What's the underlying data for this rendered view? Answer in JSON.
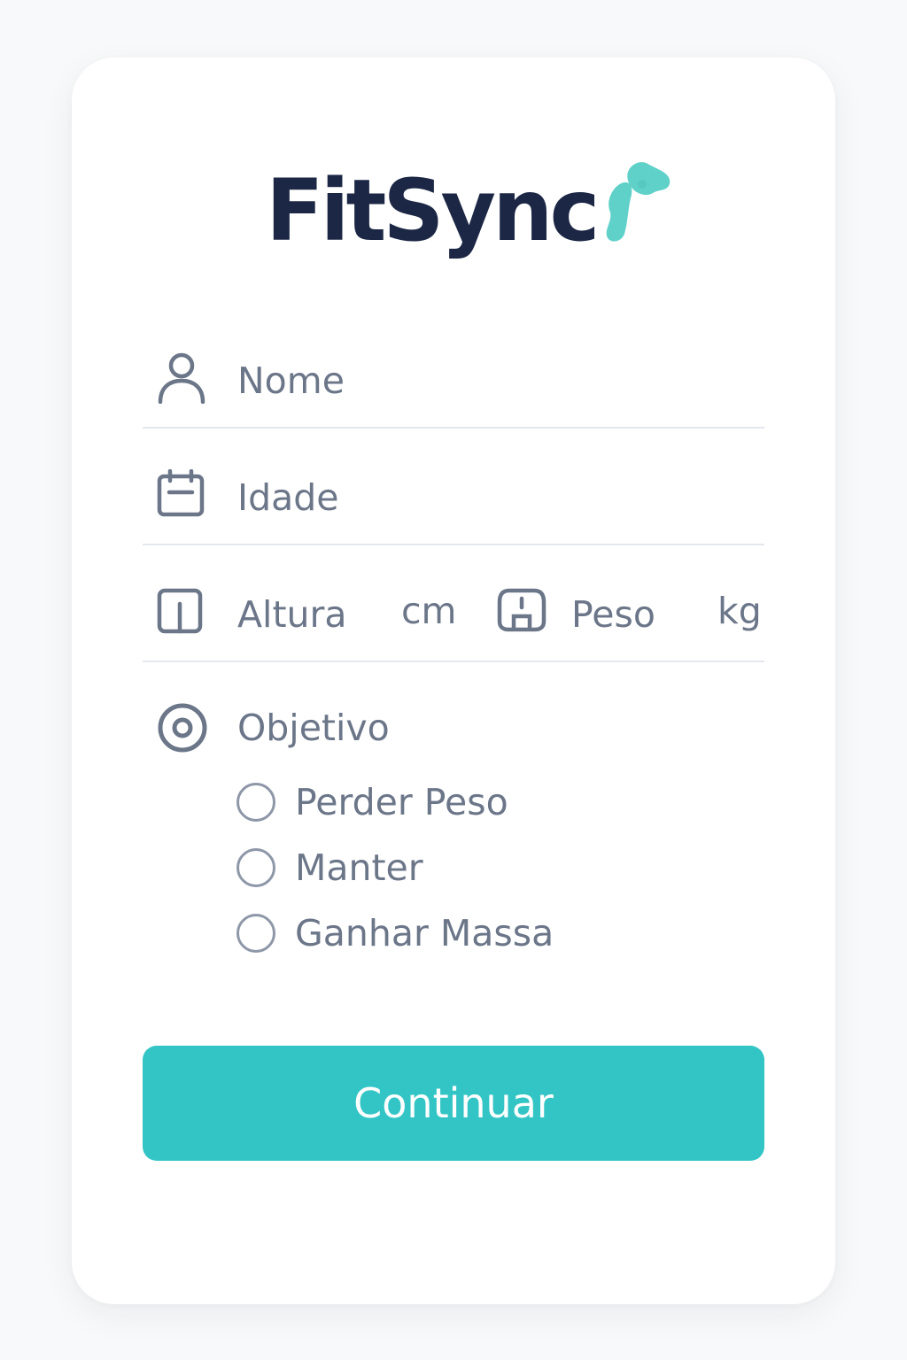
{
  "brand": {
    "name": "FitSync",
    "text_color": "#1c2745",
    "accent_color": "#5fd1c9"
  },
  "form": {
    "name": {
      "placeholder": "Nome",
      "value": "",
      "icon": "user-icon"
    },
    "age": {
      "placeholder": "Idade",
      "value": "",
      "icon": "calendar-icon"
    },
    "height": {
      "placeholder": "Altura",
      "unit": "cm",
      "value": "",
      "icon": "height-icon"
    },
    "weight": {
      "placeholder": "Peso",
      "unit": "kg",
      "value": "",
      "icon": "scale-icon"
    },
    "objective": {
      "label": "Objetivo",
      "icon": "target-icon",
      "options": [
        {
          "label": "Perder Peso",
          "selected": false
        },
        {
          "label": "Manter",
          "selected": false
        },
        {
          "label": "Ganhar Massa",
          "selected": false
        }
      ]
    },
    "submit_label": "Continuar"
  },
  "colors": {
    "button": "#33c5c5",
    "text_muted": "#6b7689",
    "divider": "#e4e8ee",
    "card": "#ffffff",
    "background": "#f8f9fa"
  }
}
